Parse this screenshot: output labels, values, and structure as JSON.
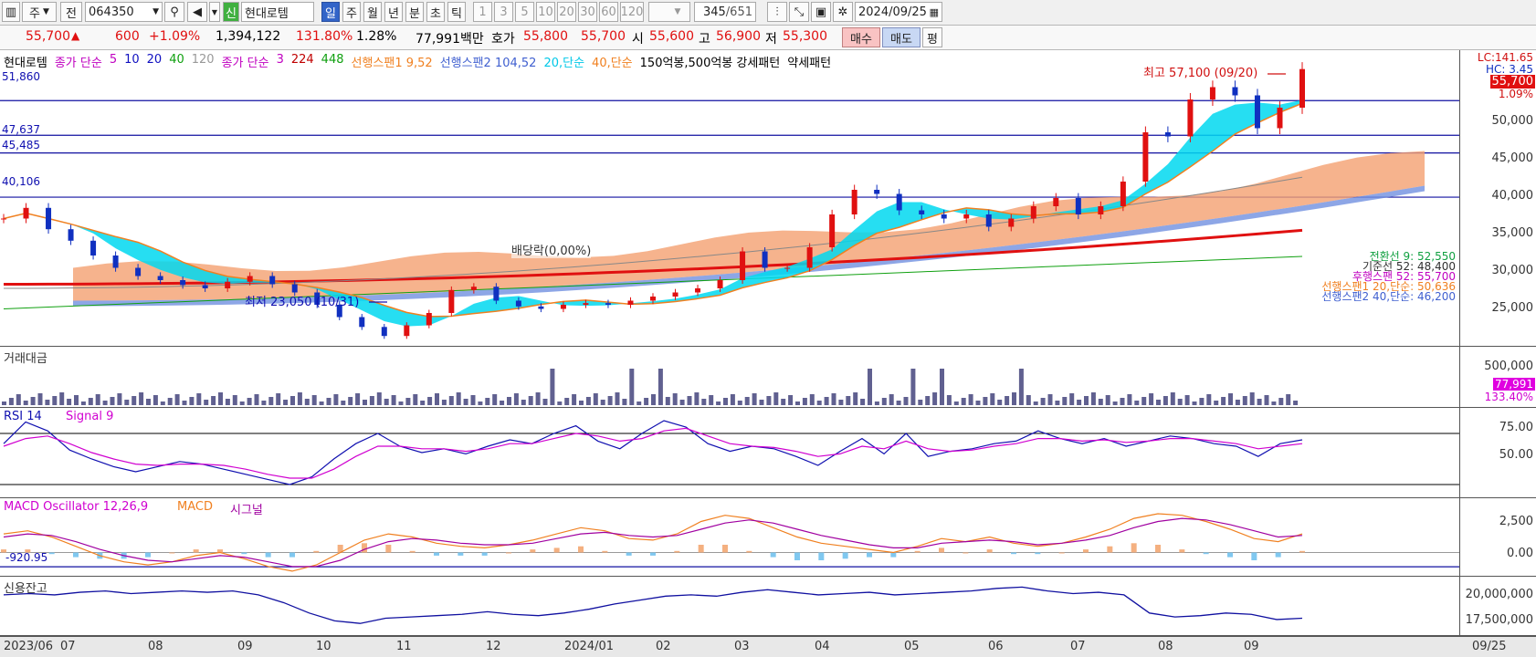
{
  "toolbar": {
    "period_select": "주",
    "mode_label": "전",
    "code_input": "064350",
    "name_badge": "신",
    "name": "현대로템",
    "period_tabs": [
      "일",
      "주",
      "월",
      "년",
      "분",
      "초",
      "틱"
    ],
    "period_selected": "일",
    "interval_buttons": [
      "1",
      "3",
      "5",
      "10",
      "20",
      "30",
      "60",
      "120"
    ],
    "count_display": "345",
    "count_total": "/651",
    "date": "2024/09/25"
  },
  "quote": {
    "price": "55,700",
    "arrow": "▲",
    "change": "600",
    "change_pct": "+1.09%",
    "volume": "1,394,122",
    "vol_ratio": "131.80%",
    "turnover": "1.28%",
    "amount": "77,991백만",
    "ask_label": "호가",
    "ask": "55,800",
    "bid": "55,700",
    "open_label": "시",
    "open": "55,600",
    "high_label": "고",
    "high": "56,900",
    "low_label": "저",
    "low": "55,300",
    "buy": "매수",
    "sell": "매도",
    "eval": "평"
  },
  "price_panel": {
    "legend": [
      {
        "text": "현대로템",
        "color": "#000000"
      },
      {
        "text": "종가 단순",
        "color": "#c000c0"
      },
      {
        "text": "5",
        "color": "#c000c0"
      },
      {
        "text": "10",
        "color": "#1010c0"
      },
      {
        "text": "20",
        "color": "#1010c0"
      },
      {
        "text": "40",
        "color": "#10a010"
      },
      {
        "text": "120",
        "color": "#999999"
      },
      {
        "text": "종가 단순",
        "color": "#c000c0"
      },
      {
        "text": "3",
        "color": "#c000c0"
      },
      {
        "text": "224",
        "color": "#c00000"
      },
      {
        "text": "448",
        "color": "#10a010"
      },
      {
        "text": "선행스팬1 9,52",
        "color": "#f08020"
      },
      {
        "text": "선행스팬2 104,52",
        "color": "#4060d0"
      },
      {
        "text": "20,단순",
        "color": "#00c8e8"
      },
      {
        "text": "40,단순",
        "color": "#f08020"
      },
      {
        "text": "150억봉,500억봉 강세패턴",
        "color": "#000000"
      },
      {
        "text": "약세패턴",
        "color": "#000000"
      }
    ],
    "hlines": [
      "51,860",
      "47,637",
      "45,485",
      "40,106"
    ],
    "yticks": [
      "50,000",
      "45,000",
      "40,000",
      "35,000",
      "30,000",
      "25,000"
    ],
    "lc_tag": "LC:141.65",
    "hc_tag": "HC: 3.45",
    "price_tag": "55,700",
    "pct_tag": "1.09%",
    "max_label": "최고 57,100 (09/20)",
    "min_label": "최저 23,050 (10/31)",
    "dividend_label": "배당락(0,00%)",
    "ichimoku": [
      {
        "text": "전환선 9: 52,550",
        "color": "#10a040"
      },
      {
        "text": "기준선 52: 48,400",
        "color": "#303030"
      },
      {
        "text": "후행스팬 52: 55,700",
        "color": "#c000c0"
      },
      {
        "text": "선행스팬1 20,단순: 50,636",
        "color": "#f08020"
      },
      {
        "text": "선행스팬2 40,단순: 46,200",
        "color": "#4060d0"
      }
    ]
  },
  "amount_panel": {
    "title": "거래대금",
    "ytick": "500,000",
    "tag1": "77,991",
    "tag2": "133.40%"
  },
  "rsi_panel": {
    "title": "RSI 14",
    "signal": "Signal 9",
    "yticks": [
      "75.00",
      "50.00"
    ]
  },
  "macd_panel": {
    "title": "MACD Oscillator 12,26,9",
    "macd": "MACD",
    "signal": "시그널",
    "value_label": "-920.95",
    "yticks": [
      "2,500",
      "0.00"
    ]
  },
  "credit_panel": {
    "title": "신용잔고",
    "yticks": [
      "20,000,000",
      "17,500,000"
    ]
  },
  "xaxis": {
    "labels": [
      "2023/06",
      "07",
      "08",
      "09",
      "10",
      "11",
      "12",
      "2024/01",
      "02",
      "03",
      "04",
      "05",
      "06",
      "07",
      "08",
      "09",
      "09/25"
    ]
  },
  "colors": {
    "up": "#e01010",
    "down": "#1030c0",
    "accent": "#3264c8",
    "cloud_up": "#f4a070",
    "cloud_down": "#7090e0",
    "ma20": "#00d8f0",
    "ma224": "#e01010"
  },
  "chart_data": [
    {
      "type": "candlestick",
      "title": "현대로템",
      "y_range": [
        22000,
        58000
      ],
      "series": [
        {
          "name": "종가",
          "values": [
            37500,
            38800,
            36200,
            34800,
            33000,
            31500,
            30500,
            30000,
            29400,
            29000,
            29800,
            30500,
            29500,
            28500,
            27000,
            25500,
            24300,
            23200,
            24500,
            26000,
            28800,
            29200,
            27500,
            26800,
            26500,
            27000,
            27200,
            27000,
            27500,
            28000,
            28500,
            29000,
            30000,
            33500,
            31500,
            31500,
            34000,
            38000,
            41000,
            40500,
            38500,
            38000,
            37500,
            38000,
            36500,
            37500,
            39000,
            40000,
            38000,
            39000,
            42000,
            48000,
            47500,
            52000,
            53500,
            52500,
            48500,
            51000,
            55700
          ]
        }
      ]
    },
    {
      "type": "bar",
      "title": "거래대금",
      "y_range": [
        0,
        600000
      ],
      "categories": [
        "09/25"
      ],
      "values": [
        77991
      ]
    },
    {
      "type": "line",
      "title": "RSI 14",
      "y_range": [
        20,
        90
      ],
      "series": [
        {
          "name": "RSI 14",
          "values": [
            62,
            79,
            72,
            57,
            50,
            44,
            40,
            44,
            48,
            46,
            42,
            38,
            34,
            30,
            36,
            50,
            62,
            70,
            60,
            55,
            58,
            54,
            60,
            65,
            62,
            70,
            76,
            64,
            58,
            70,
            80,
            75,
            62,
            56,
            60,
            58,
            52,
            45,
            56,
            66,
            54,
            70,
            52,
            56,
            58,
            62,
            64,
            72,
            66,
            62,
            66,
            60,
            64,
            68,
            66,
            62,
            60,
            52,
            62,
            65
          ]
        },
        {
          "name": "Signal 9",
          "values": [
            60,
            66,
            68,
            62,
            55,
            50,
            46,
            45,
            46,
            46,
            45,
            42,
            38,
            35,
            35,
            42,
            52,
            60,
            60,
            58,
            58,
            56,
            58,
            62,
            62,
            66,
            70,
            68,
            64,
            66,
            72,
            74,
            68,
            62,
            60,
            59,
            56,
            52,
            54,
            60,
            58,
            64,
            58,
            56,
            57,
            60,
            62,
            66,
            66,
            64,
            65,
            63,
            64,
            66,
            66,
            64,
            62,
            58,
            60,
            62
          ]
        }
      ]
    },
    {
      "type": "line",
      "title": "MACD Oscillator 12,26,9",
      "y_range": [
        -1500,
        3500
      ],
      "series": [
        {
          "name": "MACD",
          "values": [
            1200,
            1400,
            1000,
            400,
            -200,
            -600,
            -800,
            -600,
            -200,
            0,
            -400,
            -900,
            -1200,
            -800,
            0,
            800,
            1200,
            1000,
            600,
            400,
            300,
            500,
            800,
            1200,
            1600,
            1400,
            900,
            800,
            1200,
            2000,
            2400,
            2200,
            1600,
            1000,
            600,
            400,
            200,
            0,
            400,
            900,
            700,
            1000,
            600,
            400,
            600,
            1000,
            1500,
            2200,
            2500,
            2400,
            2000,
            1500,
            900,
            700,
            1200
          ]
        },
        {
          "name": "시그널",
          "values": [
            1000,
            1200,
            1100,
            700,
            200,
            -200,
            -500,
            -600,
            -400,
            -200,
            -300,
            -600,
            -900,
            -900,
            -500,
            200,
            700,
            900,
            800,
            600,
            500,
            500,
            600,
            900,
            1200,
            1300,
            1100,
            1000,
            1100,
            1500,
            1900,
            2100,
            1900,
            1500,
            1100,
            800,
            500,
            300,
            300,
            600,
            700,
            800,
            700,
            500,
            600,
            800,
            1100,
            1600,
            2000,
            2200,
            2100,
            1800,
            1400,
            1000,
            1100
          ]
        }
      ]
    },
    {
      "type": "line",
      "title": "신용잔고",
      "y_range": [
        16500000,
        21000000
      ],
      "series": [
        {
          "name": "신용잔고",
          "values": [
            19600000,
            19700000,
            19600000,
            19800000,
            19900000,
            19700000,
            19800000,
            19900000,
            19800000,
            19900000,
            19600000,
            19000000,
            18200000,
            17600000,
            17400000,
            17800000,
            17900000,
            18000000,
            18100000,
            18300000,
            18100000,
            18000000,
            18200000,
            18500000,
            18900000,
            19200000,
            19500000,
            19600000,
            19500000,
            19800000,
            20000000,
            19800000,
            19600000,
            19700000,
            19800000,
            19600000,
            19700000,
            19800000,
            19900000,
            20100000,
            20200000,
            19900000,
            19700000,
            19800000,
            19600000,
            18200000,
            17900000,
            18000000,
            18200000,
            18100000,
            17700000,
            17800000
          ]
        }
      ]
    }
  ]
}
